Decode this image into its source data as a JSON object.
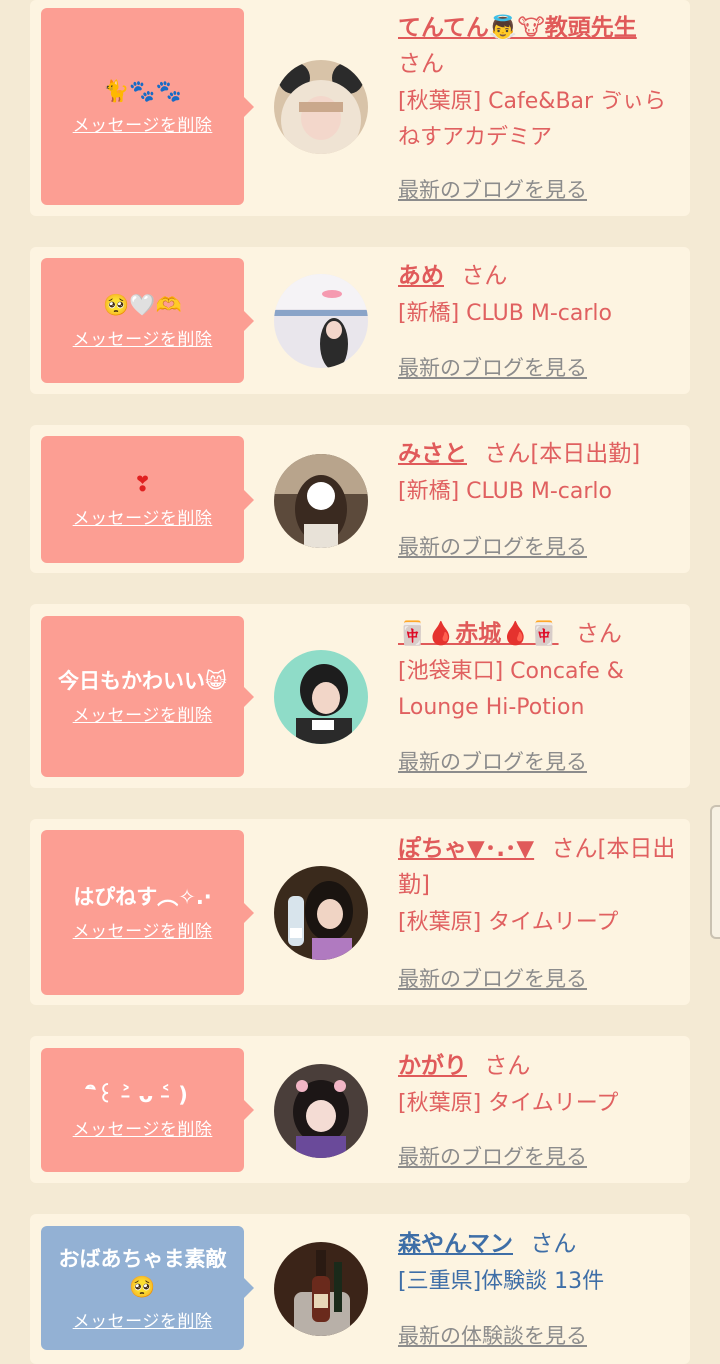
{
  "delete_label": "メッセージを削除",
  "items": [
    {
      "message": "🐈🐾🐾",
      "name": "てんてん👼🐮教頭先生",
      "san": "さん",
      "shop": "[秋葉原] Cafe&Bar ゔぃらねすアカデミア",
      "link": "最新のブログを見る"
    },
    {
      "message": "🥺🤍🫶",
      "name": "あめ",
      "san": "さん",
      "shop": "[新橋] CLUB M-carlo",
      "link": "最新のブログを見る"
    },
    {
      "message": "❣",
      "name": "みさと",
      "san": "さん[本日出勤]",
      "shop": "[新橋] CLUB M-carlo",
      "link": "最新のブログを見る"
    },
    {
      "message": "今日もかわいい😸",
      "name": "🀄🩸赤城🩸🀄",
      "san": "さん",
      "shop": "[池袋東口] Concafe & Lounge Hi-Potion",
      "link": "最新のブログを見る"
    },
    {
      "message": "はぴねす︵✧.·",
      "name": "ぽちゃ▼･.･▼",
      "san": "さん[本日出勤]",
      "shop": "[秋葉原] タイムリープ",
      "link": "最新のブログを見る"
    },
    {
      "message": "ิ꒰ ˃̵ ᴗ ˂̵ )",
      "name": "かがり",
      "san": "さん",
      "shop": "[秋葉原] タイムリープ",
      "link": "最新のブログを見る"
    },
    {
      "message": "おばあちゃま素敵🥺",
      "name": "森やんマン",
      "san": "さん",
      "shop": "[三重県]体験談 13件",
      "link": "最新の体験談を見る"
    }
  ],
  "colors": {
    "background": "#f4ead4",
    "card": "#fdf4e1",
    "bubble_pink": "#fc9e93",
    "bubble_blue": "#93b1d4",
    "name_red": "#e05a5a",
    "name_blue": "#3e6ea7",
    "link_gray": "#8c8c8c"
  }
}
